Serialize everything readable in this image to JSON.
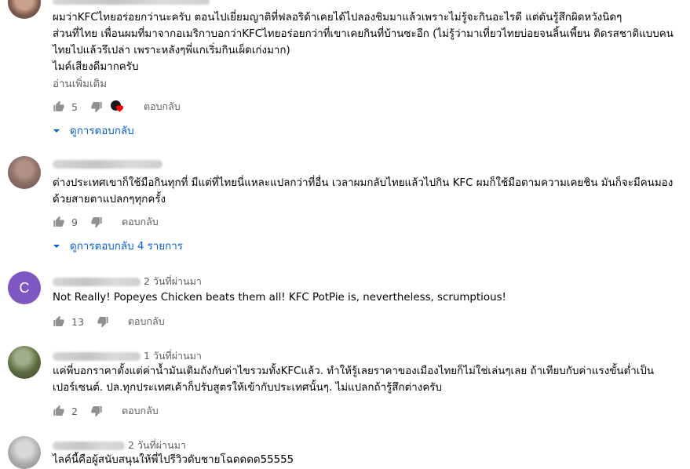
{
  "comments": [
    {
      "text": "ผมว่าKFCไทยอร่อยกว่านะครับ ตอนไปเยี่ยมญาติที่ฟลอริด้าเคยได้ไปลองชิมมาแล้วเพราะไม่รู้จะกินอะไรดี แต่ดันรู้สึกผิดหวังนิดๆ\nส่วนที่ไทย เพื่อนผมที่มาจากอเมริกาบอกว่าKFCไทยอร่อยกว่าที่เขาเคยกินที่บ้านซะอีก (ไม่รู้ว่ามาเที่ยวไทยบ่อยจนลิ้นเพี้ยน ติดรสชาติแบบคน\nไทยไปแล้วรึเปล่า เพราะหลังๆพี่แกเริ่มกินเผ็ดเก่งมาก)\nไมค์เสียงดีมากครับ",
      "read_more": "อ่านเพิ่มเติม",
      "likes": "5",
      "reply_label": "ตอบกลับ",
      "view_replies": "ดูการตอบกลับ"
    },
    {
      "time": "",
      "text": "ต่างประเทศเขาก็ใช้มือกินทุกที่ มีแต่ที่ไทยนี่แหละแปลกว่าที่อื่น เวลาผมกลับไทยแล้วไปกิน KFC ผมก็ใช้มือตามความเคยชิน มันก็จะมีคนมอง\nด้วยสายตาแปลกๆทุกครั้ง",
      "likes": "9",
      "reply_label": "ตอบกลับ",
      "view_replies": "ดูการตอบกลับ 4 รายการ"
    },
    {
      "avatar_letter": "C",
      "time": "2 วันที่ผ่านมา",
      "text": "Not Really! Popeyes Chicken beats them all! KFC PotPie is, nevertheless, scrumptious!",
      "likes": "13",
      "reply_label": "ตอบกลับ"
    },
    {
      "time": "1 วันที่ผ่านมา",
      "text": "แค่พี่บอกราคาตั้งแต่ค่าน้ำมันเติมถังกับค่าไขรวมทั้งKFCแล้ว.  ทำให้รู้เลยราคาของเมืองไทยก็ไม่ใช่เล่นๆเลย ถ้าเทียบกับค่าแรงขั้นต่ำเป็น\nเปอร์เซนต์.  ปล.ทุกประเทศเค้าก็ปรับสูตรให้เข้ากับประเทศนั้นๆ.   ไม่แปลกถ้ารู้สึกต่างครับ",
      "likes": "2",
      "reply_label": "ตอบกลับ"
    },
    {
      "time": "2 วันที่ผ่านมา",
      "text": "ไลค์นี้คือผู้สนับสนุนให้พี่ไปรีวิวดับชายโฉดดดด55555"
    }
  ],
  "colors": {
    "avatar_purple": "#7e57c2",
    "link_blue": "#065fd4",
    "heart_red": "#ff0000"
  }
}
